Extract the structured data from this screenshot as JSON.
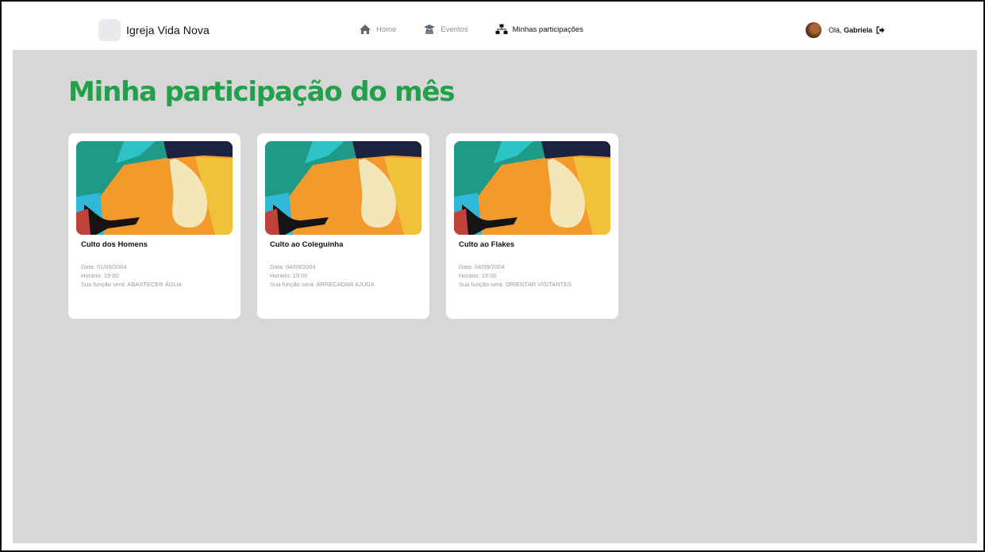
{
  "brand": {
    "name": "Igreja Vida Nova"
  },
  "nav": {
    "items": [
      {
        "label": "Home",
        "icon": "home-icon",
        "active": false
      },
      {
        "label": "Eventos",
        "icon": "graduation-cap-icon",
        "active": false
      },
      {
        "label": "Minhas participações",
        "icon": "sitemap-icon",
        "active": true
      }
    ]
  },
  "user": {
    "greeting": "Olá,",
    "name": "Gabriela",
    "logout_icon": "logout-icon"
  },
  "page": {
    "title": "Minha participação do mês"
  },
  "colors": {
    "accent": "#22a04b",
    "background": "#d7d7d7",
    "card": "#ffffff"
  },
  "cards": [
    {
      "title": "Culto dos Homens",
      "date": "Data: 01/09/2004",
      "time": "Horário: 19:00",
      "role": "Sua função será: ABASTECER ÁGUA"
    },
    {
      "title": "Culto ao Coleguinha",
      "date": "Data: 04/09/2004",
      "time": "Horário: 19:00",
      "role": "Sua função será: ARRECADAR AJUDA"
    },
    {
      "title": "Culto ao Flakes",
      "date": "Data: 04/09/2004",
      "time": "Horário: 19:00",
      "role": "Sua função será: ORIENTAR  VISITANTES"
    }
  ]
}
